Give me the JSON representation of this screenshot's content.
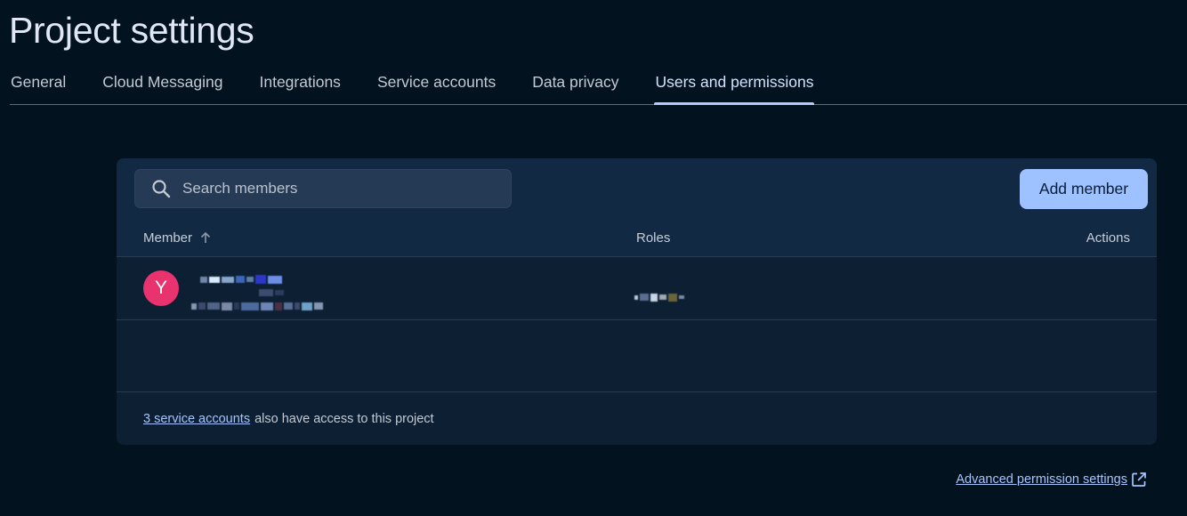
{
  "page": {
    "title": "Project settings"
  },
  "tabs": [
    {
      "label": "General",
      "active": false
    },
    {
      "label": "Cloud Messaging",
      "active": false
    },
    {
      "label": "Integrations",
      "active": false
    },
    {
      "label": "Service accounts",
      "active": false
    },
    {
      "label": "Data privacy",
      "active": false
    },
    {
      "label": "Users and permissions",
      "active": true
    }
  ],
  "search": {
    "icon": "search-icon",
    "placeholder": "Search members",
    "value": ""
  },
  "add_member_label": "Add member",
  "table": {
    "columns": {
      "member": "Member",
      "roles": "Roles",
      "actions": "Actions"
    },
    "sort_icon": "arrow-up-icon",
    "rows": [
      {
        "avatar_letter": "Y",
        "avatar_color": "#e8336f"
      }
    ]
  },
  "footer": {
    "link_text": "3 service accounts",
    "text": "also have access to this project"
  },
  "advanced_link": {
    "label": "Advanced permission settings",
    "icon": "external-link-icon"
  },
  "colors": {
    "background": "#03121f",
    "card": "#0c1f33",
    "accent": "#9ec1ff",
    "link": "#a8c4ff",
    "avatar": "#e8336f"
  }
}
